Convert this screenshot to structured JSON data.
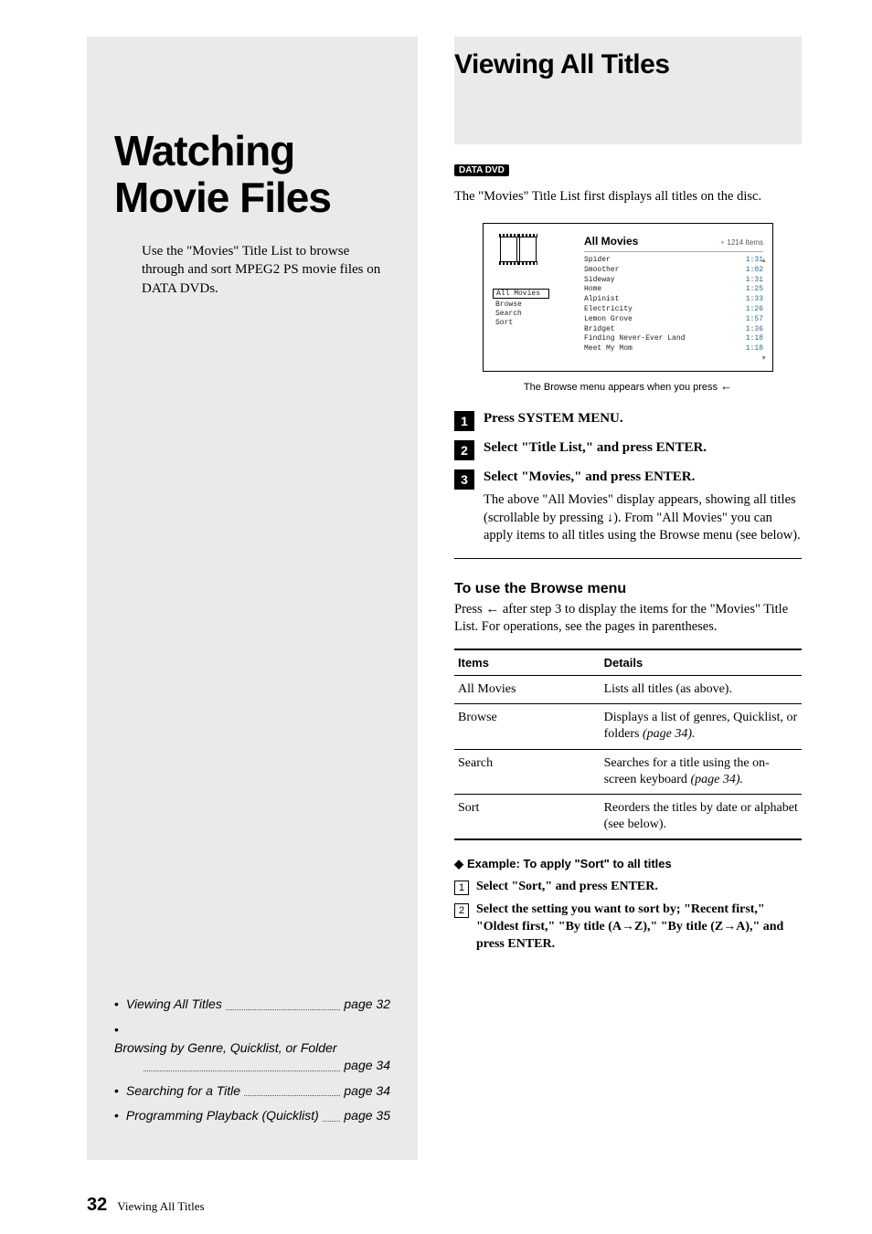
{
  "sidebar": {
    "chapter_title": "Watching Movie Files",
    "intro": "Use the \"Movies\" Title List to browse through and sort  MPEG2 PS movie files on DATA DVDs.",
    "toc": [
      {
        "label": "Viewing All Titles",
        "page": "page 32"
      },
      {
        "label": "Browsing by Genre, Quicklist, or Folder",
        "page": "page 34",
        "wrap": true
      },
      {
        "label": "Searching for a Title",
        "page": "page 34"
      },
      {
        "label": "Programming Playback (Quicklist)",
        "page": "page 35"
      }
    ]
  },
  "main": {
    "title": "Viewing All Titles",
    "badge": "DATA DVD",
    "lead": "The \"Movies\" Title List first displays all titles on the disc.",
    "screenshot": {
      "heading": "All Movies",
      "count": "1214 Items",
      "nav": [
        "All Movies",
        "Browse",
        "Search",
        "Sort"
      ],
      "rows": [
        {
          "t": "Spider",
          "d": "1:31"
        },
        {
          "t": "Smoother",
          "d": "1:02"
        },
        {
          "t": "Sideway",
          "d": "1:31"
        },
        {
          "t": "Home",
          "d": "1:25"
        },
        {
          "t": "Alpinist",
          "d": "1:33"
        },
        {
          "t": "Electricity",
          "d": "1:26"
        },
        {
          "t": "Lemon Grove",
          "d": "1:57"
        },
        {
          "t": "Bridget",
          "d": "1:36"
        },
        {
          "t": "Finding Never-Ever Land",
          "d": "1:18"
        },
        {
          "t": "Meet My Mom",
          "d": "1:18"
        }
      ]
    },
    "caption": "The Browse menu appears when you press ",
    "caption_sym": "←",
    "steps": [
      {
        "n": "1",
        "title": "Press SYSTEM MENU.",
        "body": ""
      },
      {
        "n": "2",
        "title": "Select \"Title List,\" and press ENTER.",
        "body": ""
      },
      {
        "n": "3",
        "title": "Select \"Movies,\" and press ENTER.",
        "body": "The above \"All Movies\" display appears, showing all titles (scrollable by pressing ↓). From \"All Movies\" you can apply items to all titles using the Browse menu (see below)."
      }
    ],
    "browse": {
      "heading": "To use the Browse menu",
      "text_a": "Press ",
      "text_sym": "←",
      "text_b": " after step 3 to display the items for the \"Movies\" Title List. For operations, see the pages in parentheses.",
      "th1": "Items",
      "th2": "Details",
      "rows": [
        {
          "i": "All Movies",
          "d": "Lists all titles (as above)."
        },
        {
          "i": "Browse",
          "d": "Displays a list of genres, Quicklist, or folders ",
          "pref": "(page 34)."
        },
        {
          "i": "Search",
          "d": "Searches for a title using the on-screen keyboard ",
          "pref": "(page 34)."
        },
        {
          "i": "Sort",
          "d": "Reorders the titles by date or alphabet (see below)."
        }
      ]
    },
    "example": {
      "heading": "Example: To apply \"Sort\" to all titles",
      "steps": [
        {
          "n": "1",
          "body": "Select \"Sort,\" and press ENTER."
        },
        {
          "n": "2",
          "body": "Select the setting you want to sort by; \"Recent first,\" \"Oldest first,\" \"By title (A→Z),\" \"By title (Z→A),\" and press ENTER."
        }
      ]
    }
  },
  "footer": {
    "page_num": "32",
    "section": "Viewing All Titles"
  }
}
